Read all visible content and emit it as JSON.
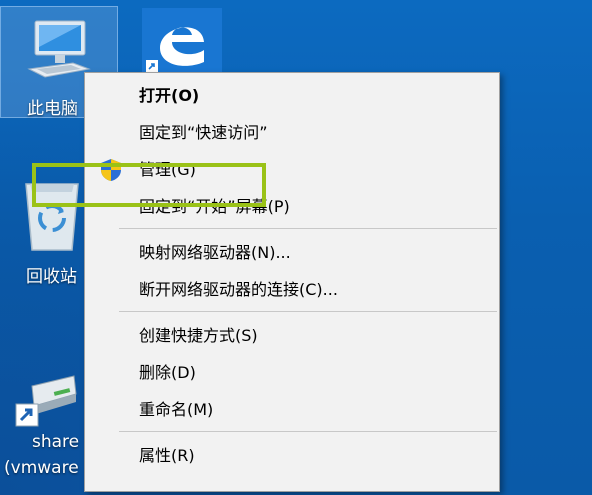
{
  "desktop": {
    "icons": [
      {
        "name": "this-pc",
        "label": "此电脑"
      },
      {
        "name": "edge",
        "label": ""
      },
      {
        "name": "recycle-bin",
        "label": "回收站"
      },
      {
        "name": "network-share",
        "label_line1": "share",
        "label_line2": "(vmware"
      }
    ]
  },
  "context_menu": {
    "items": [
      {
        "label": "打开(O)",
        "bold": true
      },
      {
        "label": "固定到“快速访问”"
      },
      {
        "label": "管理(G)",
        "icon": "uac-shield-icon"
      },
      {
        "label": "固定到“开始”屏幕(P)"
      },
      {
        "label": "映射网络驱动器(N)...",
        "highlighted": true
      },
      {
        "label": "断开网络驱动器的连接(C)..."
      },
      {
        "label": "创建快捷方式(S)"
      },
      {
        "label": "删除(D)"
      },
      {
        "label": "重命名(M)"
      },
      {
        "label": "属性(R)"
      }
    ],
    "highlight_color": "#9ac217"
  },
  "colors": {
    "desktop_bg": "#0a62b2",
    "menu_bg": "#f2f2f2",
    "selection": "#78aadc"
  }
}
